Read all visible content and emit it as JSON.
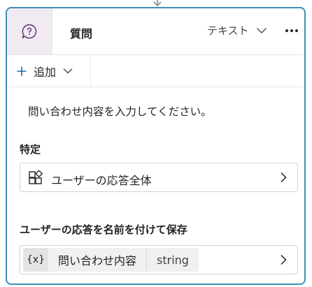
{
  "node": {
    "title": "質問",
    "icon": "question-chat-icon",
    "response_type": "テキスト",
    "more_icon": "more-horizontal-icon",
    "accent_color": "#3b8fb6",
    "icon_bg_color": "#f1eaf3"
  },
  "add": {
    "label": "追加",
    "icon": "plus-icon"
  },
  "message": "問い合わせ内容を入力してください。",
  "identify": {
    "label": "特定",
    "entity": "ユーザーの応答全体",
    "icon": "entity-icon"
  },
  "save": {
    "label": "ユーザーの応答を名前を付けて保存",
    "variable_icon": "{x}",
    "variable_name": "問い合わせ内容",
    "variable_type": "string"
  }
}
